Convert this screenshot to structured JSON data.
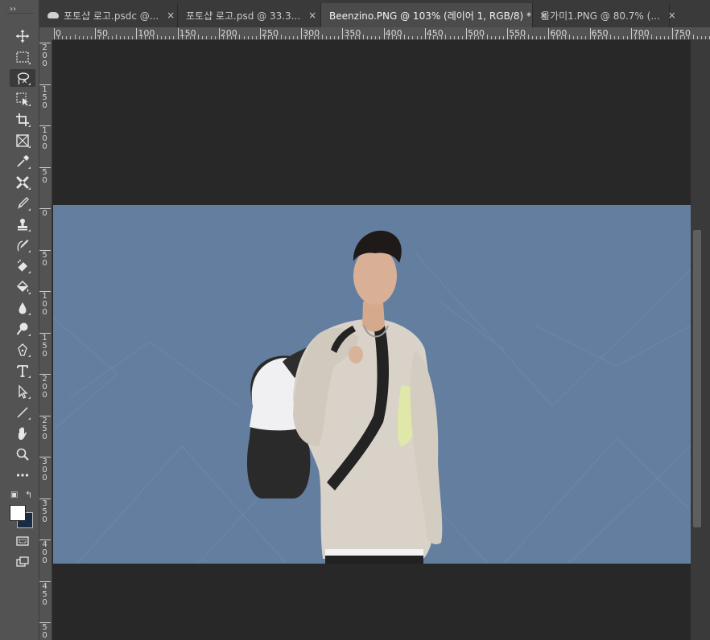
{
  "tabs": [
    {
      "label": "포토샵 로고.psdc @...",
      "cloud": true,
      "close": "×"
    },
    {
      "label": "포토샵 로고.psd @ 33.3...",
      "cloud": false,
      "close": "×"
    },
    {
      "label": "Beenzino.PNG @ 103% (레이어 1, RGB/8) *",
      "cloud": false,
      "close": "×",
      "active": true
    },
    {
      "label": "올가미1.PNG @ 80.7% (...",
      "cloud": false,
      "close": "×"
    }
  ],
  "toolbar": {
    "gripper": "››",
    "tools": [
      {
        "name": "move-tool",
        "icon": "move-icon"
      },
      {
        "name": "marquee-tool",
        "icon": "marquee-icon"
      },
      {
        "name": "lasso-tool",
        "icon": "lasso-icon",
        "active": true
      },
      {
        "name": "object-select-tool",
        "icon": "object-select-icon"
      },
      {
        "name": "crop-tool",
        "icon": "crop-icon"
      },
      {
        "name": "frame-tool",
        "icon": "frame-icon"
      },
      {
        "name": "eyedropper-tool",
        "icon": "eyedropper-icon"
      },
      {
        "name": "healing-tool",
        "icon": "healing-icon"
      },
      {
        "name": "brush-tool",
        "icon": "brush-icon"
      },
      {
        "name": "clone-stamp-tool",
        "icon": "stamp-icon"
      },
      {
        "name": "history-brush-tool",
        "icon": "history-brush-icon"
      },
      {
        "name": "eraser-tool",
        "icon": "eraser-icon"
      },
      {
        "name": "paint-bucket-tool",
        "icon": "paint-bucket-icon"
      },
      {
        "name": "blur-tool",
        "icon": "droplet-icon"
      },
      {
        "name": "dodge-tool",
        "icon": "dodge-icon"
      },
      {
        "name": "pen-tool",
        "icon": "pen-icon"
      },
      {
        "name": "type-tool",
        "icon": "type-icon"
      },
      {
        "name": "path-select-tool",
        "icon": "arrow-icon"
      },
      {
        "name": "line-tool",
        "icon": "line-icon"
      },
      {
        "name": "hand-tool",
        "icon": "hand-icon"
      },
      {
        "name": "zoom-tool",
        "icon": "zoom-icon"
      },
      {
        "name": "more-tools",
        "icon": "ellipsis-icon"
      }
    ],
    "type_glyph": "T",
    "more_glyph": "•••",
    "foreground_color": "#ffffff",
    "background_color": "#1a2b45"
  },
  "ruler": {
    "h_labels": [
      "0",
      "50",
      "100",
      "150",
      "200",
      "250",
      "300",
      "350",
      "400",
      "450",
      "500",
      "550",
      "600",
      "650",
      "700",
      "750"
    ],
    "v_labels": [
      "200",
      "150",
      "100",
      "50",
      "0",
      "50",
      "100",
      "150",
      "200",
      "250",
      "300",
      "350",
      "400",
      "450",
      "500"
    ]
  },
  "canvas": {
    "image_background": "#637e9f",
    "workspace_color": "#282828"
  }
}
